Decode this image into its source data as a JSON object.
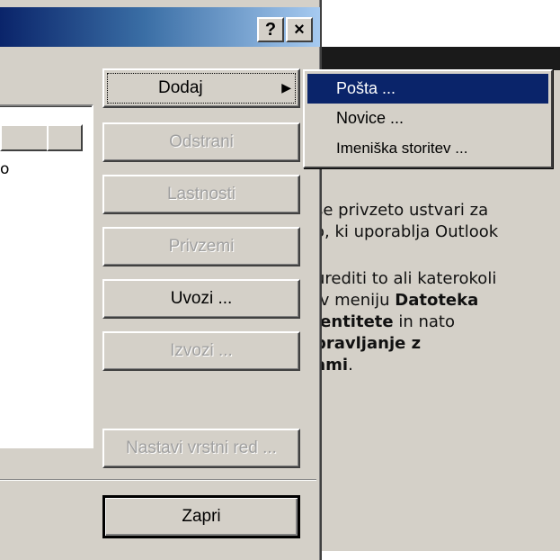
{
  "titlebar": {
    "help_label": "?",
    "close_label": "×"
  },
  "list": {
    "item_fragment": "o"
  },
  "buttons": {
    "dodaj": "Dodaj",
    "dodaj_arrow": "▶",
    "odstrani": "Odstrani",
    "lastnosti": "Lastnosti",
    "privzemi": "Privzemi",
    "uvozi": "Uvozi ...",
    "izvozi": "Izvozi ...",
    "nastavi": "Nastavi vrstni red ...",
    "zapri": "Zapri"
  },
  "menu": {
    "items": [
      {
        "label": "Pošta ...",
        "selected": true
      },
      {
        "label": "Novice ...",
        "selected": false
      },
      {
        "label": "Imeniška storitev ...",
        "selected": false
      }
    ]
  },
  "background_text": {
    "line1": "se privzeto ustvari za",
    "line2": "o, ki uporablja Outlook",
    "line3": "urediti to ali katerokoli",
    "line4_pre": "v meniju ",
    "line4_bold": "Datoteka",
    "line5_bold": "lentitete",
    "line5_post": " in nato",
    "line6_bold": "pravljanje z",
    "line7_bold": "ami",
    "line7_post": "."
  },
  "colors": {
    "dialog_face": "#d4d0c8",
    "menu_selection": "#0a246a",
    "title_gradient_start": "#0a246a",
    "title_gradient_end": "#a6caf0",
    "disabled_text": "#a0a0a0"
  }
}
